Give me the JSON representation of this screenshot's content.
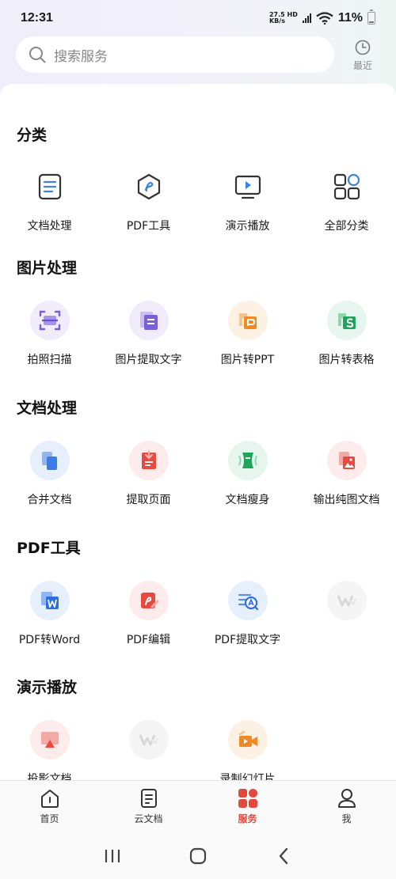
{
  "status_bar": {
    "time": "12:31",
    "net_speed_value": "27.5",
    "net_speed_unit": "KB/s",
    "net_type": "HD",
    "battery": "11%"
  },
  "search": {
    "placeholder": "搜索服务"
  },
  "recent": {
    "label": "最近"
  },
  "sections": [
    {
      "title": "分类",
      "items": [
        {
          "label": "文档处理",
          "icon": "document-icon"
        },
        {
          "label": "PDF工具",
          "icon": "pdf-tool-icon"
        },
        {
          "label": "演示播放",
          "icon": "presentation-icon"
        },
        {
          "label": "全部分类",
          "icon": "all-categories-icon"
        }
      ]
    },
    {
      "title": "图片处理",
      "items": [
        {
          "label": "拍照扫描",
          "icon": "scan-icon"
        },
        {
          "label": "图片提取文字",
          "icon": "image-text-extract-icon"
        },
        {
          "label": "图片转PPT",
          "icon": "image-to-ppt-icon"
        },
        {
          "label": "图片转表格",
          "icon": "image-to-sheet-icon"
        }
      ]
    },
    {
      "title": "文档处理",
      "items": [
        {
          "label": "合并文档",
          "icon": "merge-docs-icon"
        },
        {
          "label": "提取页面",
          "icon": "extract-pages-icon"
        },
        {
          "label": "文档瘦身",
          "icon": "slim-doc-icon"
        },
        {
          "label": "输出纯图文档",
          "icon": "image-doc-export-icon"
        }
      ]
    },
    {
      "title": "PDF工具",
      "items": [
        {
          "label": "PDF转Word",
          "icon": "pdf-to-word-icon"
        },
        {
          "label": "PDF编辑",
          "icon": "pdf-edit-icon"
        },
        {
          "label": "PDF提取文字",
          "icon": "pdf-text-extract-icon"
        },
        {
          "label": "",
          "icon": "wps-placeholder-icon"
        }
      ]
    },
    {
      "title": "演示播放",
      "items": [
        {
          "label": "投影文档",
          "icon": "projection-icon"
        },
        {
          "label": "",
          "icon": "wps-placeholder-icon"
        },
        {
          "label": "录制幻灯片",
          "icon": "record-slides-icon"
        }
      ]
    }
  ],
  "bottom_nav": [
    {
      "label": "首页",
      "icon": "home-icon",
      "active": false
    },
    {
      "label": "云文档",
      "icon": "cloud-docs-icon",
      "active": false
    },
    {
      "label": "服务",
      "icon": "services-icon",
      "active": true
    },
    {
      "label": "我",
      "icon": "profile-icon",
      "active": false
    }
  ],
  "colors": {
    "accent": "#e0493d",
    "card_bg": "#ffffff",
    "page_bg": "#f3f3f6"
  }
}
